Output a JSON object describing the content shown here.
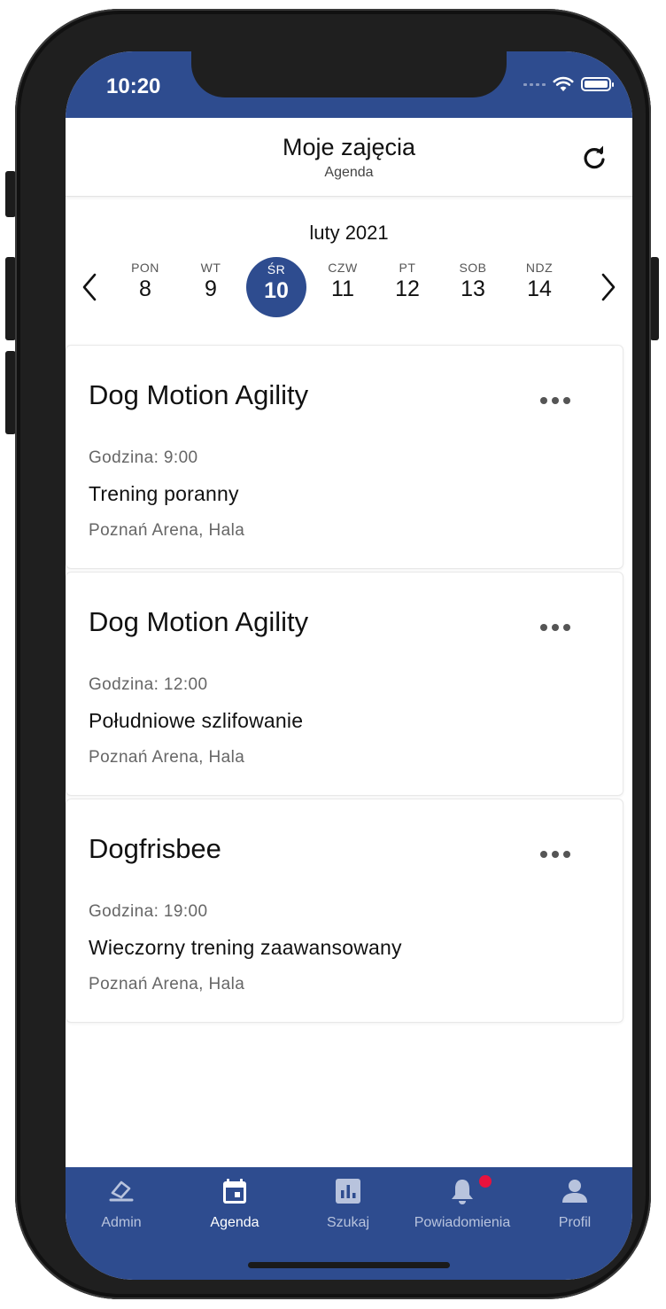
{
  "status_bar": {
    "time": "10:20"
  },
  "header": {
    "title": "Moje zajęcia",
    "subtitle": "Agenda",
    "refresh_icon": "refresh-icon"
  },
  "calendar": {
    "month": "luty 2021",
    "days": [
      {
        "name": "PON",
        "number": "8"
      },
      {
        "name": "WT",
        "number": "9"
      },
      {
        "name": "ŚR",
        "number": "10",
        "selected": true
      },
      {
        "name": "CZW",
        "number": "11"
      },
      {
        "name": "PT",
        "number": "12"
      },
      {
        "name": "SOB",
        "number": "13"
      },
      {
        "name": "NDZ",
        "number": "14"
      }
    ]
  },
  "events": [
    {
      "title": "Dog Motion Agility",
      "time": "Godzina: 9:00",
      "description": "Trening poranny",
      "location": "Poznań Arena, Hala"
    },
    {
      "title": "Dog Motion Agility",
      "time": "Godzina: 12:00",
      "description": "Południowe szlifowanie",
      "location": "Poznań Arena, Hala"
    },
    {
      "title": "Dogfrisbee",
      "time": "Godzina: 19:00",
      "description": "Wieczorny trening zaawansowany",
      "location": "Poznań Arena, Hala"
    }
  ],
  "tabbar": {
    "tabs": [
      {
        "label": "Admin",
        "icon": "admin-stamp-icon"
      },
      {
        "label": "Agenda",
        "icon": "calendar-icon",
        "active": true
      },
      {
        "label": "Szukaj",
        "icon": "chart-icon"
      },
      {
        "label": "Powiadomienia",
        "icon": "bell-icon",
        "badge": true
      },
      {
        "label": "Profil",
        "icon": "person-icon"
      }
    ]
  },
  "colors": {
    "primary": "#2e4c8f",
    "badge": "#e8123d",
    "inactive_tab": "#b8c3dd"
  }
}
